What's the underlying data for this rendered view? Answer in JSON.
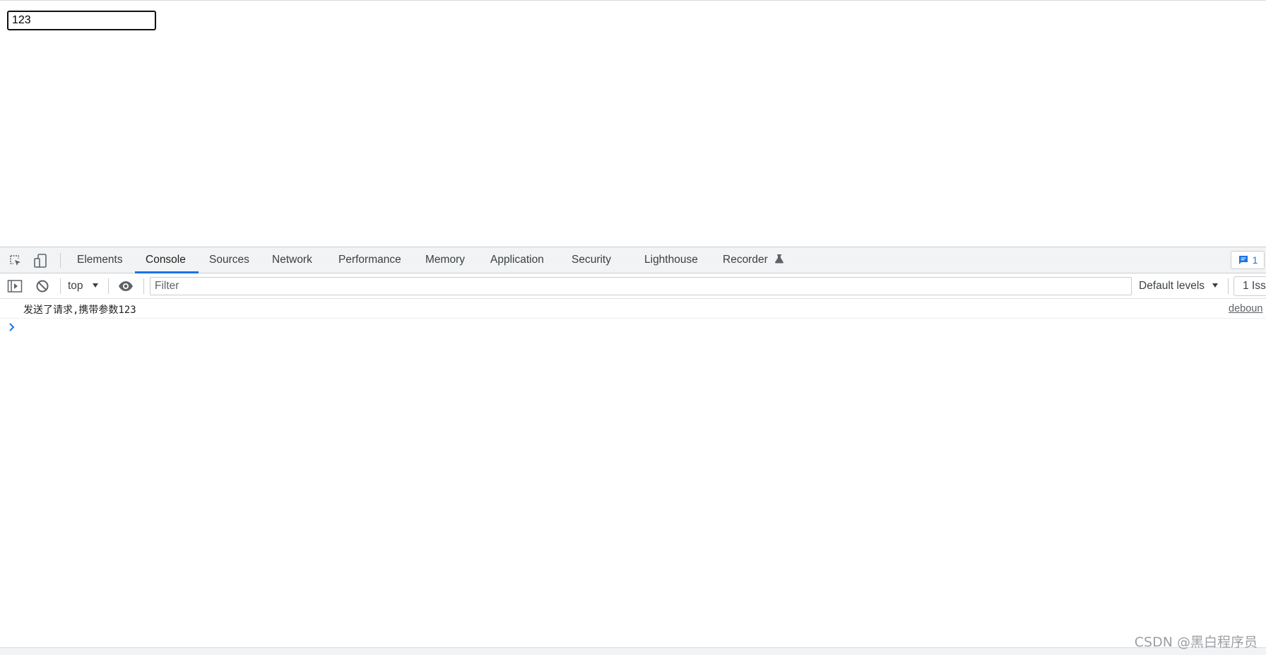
{
  "page": {
    "input_value": "123"
  },
  "devtools": {
    "tabs": [
      {
        "label": "Elements"
      },
      {
        "label": "Console"
      },
      {
        "label": "Sources"
      },
      {
        "label": "Network"
      },
      {
        "label": "Performance"
      },
      {
        "label": "Memory"
      },
      {
        "label": "Application"
      },
      {
        "label": "Security"
      },
      {
        "label": "Lighthouse"
      },
      {
        "label": "Recorder"
      }
    ],
    "active_tab": "Console",
    "issues_badge_count": "1",
    "accent_color": "#1a73e8",
    "toolbar": {
      "context": "top",
      "filter_placeholder": "Filter",
      "levels": "Default levels",
      "issues_count_label": "1 Iss"
    },
    "console": {
      "messages": [
        {
          "text": "发送了请求,携带参数123",
          "source": "deboun"
        }
      ]
    }
  },
  "watermark": "CSDN @黑白程序员"
}
